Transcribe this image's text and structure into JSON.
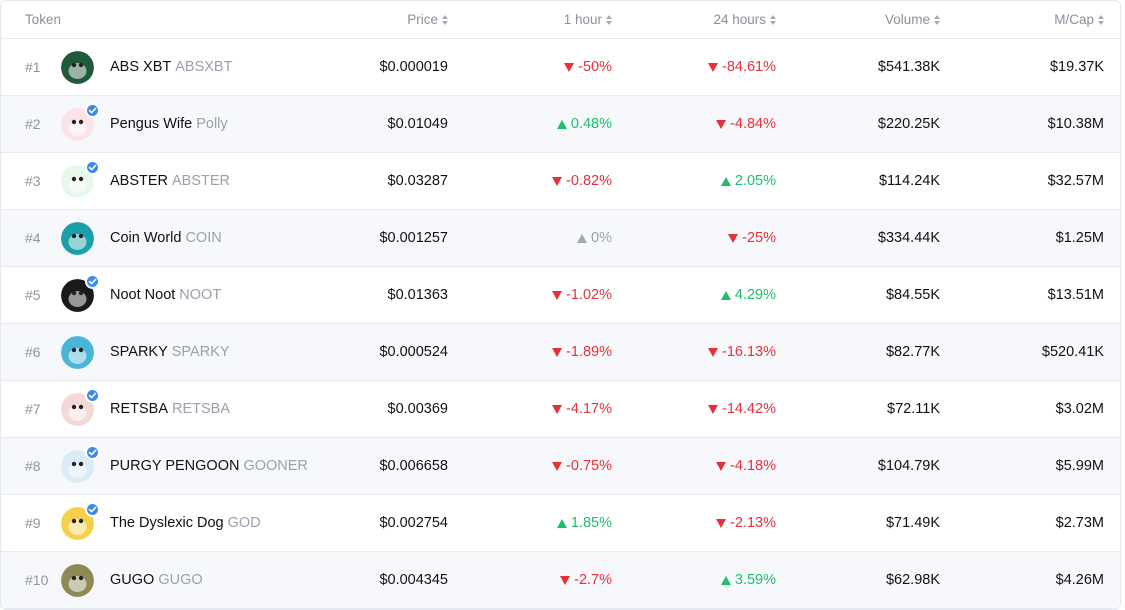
{
  "header": {
    "token": "Token",
    "price": "Price",
    "h1": "1 hour",
    "h24": "24 hours",
    "volume": "Volume",
    "mcap": "M/Cap"
  },
  "rows": [
    {
      "rank": "#1",
      "name": "ABS XBT",
      "symbol": "ABSXBT",
      "verified": false,
      "price": "$0.000019",
      "h1": "-50%",
      "h1_dir": "down",
      "h24": "-84.61%",
      "h24_dir": "down",
      "volume": "$541.38K",
      "mcap": "$19.37K",
      "avatar_color": "#1f5a3a",
      "avatar_icon": "frog-avatar-icon"
    },
    {
      "rank": "#2",
      "name": "Pengus Wife",
      "symbol": "Polly",
      "verified": true,
      "price": "$0.01049",
      "h1": "0.48%",
      "h1_dir": "up",
      "h24": "-4.84%",
      "h24_dir": "down",
      "volume": "$220.25K",
      "mcap": "$10.38M",
      "avatar_color": "#fbe3ea",
      "avatar_icon": "pink-penguin-avatar-icon"
    },
    {
      "rank": "#3",
      "name": "ABSTER",
      "symbol": "ABSTER",
      "verified": true,
      "price": "$0.03287",
      "h1": "-0.82%",
      "h1_dir": "down",
      "h24": "2.05%",
      "h24_dir": "up",
      "volume": "$114.24K",
      "mcap": "$32.57M",
      "avatar_color": "#e6f7ec",
      "avatar_icon": "green-mascot-avatar-icon"
    },
    {
      "rank": "#4",
      "name": "Coin World",
      "symbol": "COIN",
      "verified": false,
      "price": "$0.001257",
      "h1": "0%",
      "h1_dir": "flat",
      "h24": "-25%",
      "h24_dir": "down",
      "volume": "$334.44K",
      "mcap": "$1.25M",
      "avatar_color": "#1aa0a8",
      "avatar_icon": "penguin-avatar-icon"
    },
    {
      "rank": "#5",
      "name": "Noot Noot",
      "symbol": "NOOT",
      "verified": true,
      "price": "$0.01363",
      "h1": "-1.02%",
      "h1_dir": "down",
      "h24": "4.29%",
      "h24_dir": "up",
      "volume": "$84.55K",
      "mcap": "$13.51M",
      "avatar_color": "#1a1a1a",
      "avatar_icon": "black-penguin-avatar-icon"
    },
    {
      "rank": "#6",
      "name": "SPARKY",
      "symbol": "SPARKY",
      "verified": false,
      "price": "$0.000524",
      "h1": "-1.89%",
      "h1_dir": "down",
      "h24": "-16.13%",
      "h24_dir": "down",
      "volume": "$82.77K",
      "mcap": "$520.41K",
      "avatar_color": "#47b6d8",
      "avatar_icon": "spark-avatar-icon"
    },
    {
      "rank": "#7",
      "name": "RETSBA",
      "symbol": "RETSBA",
      "verified": true,
      "price": "$0.00369",
      "h1": "-4.17%",
      "h1_dir": "down",
      "h24": "-14.42%",
      "h24_dir": "down",
      "volume": "$72.11K",
      "mcap": "$3.02M",
      "avatar_color": "#f4d9d9",
      "avatar_icon": "red-mascot-avatar-icon"
    },
    {
      "rank": "#8",
      "name": "PURGY PENGOON",
      "symbol": "GOONER",
      "verified": true,
      "price": "$0.006658",
      "h1": "-0.75%",
      "h1_dir": "down",
      "h24": "-4.18%",
      "h24_dir": "down",
      "volume": "$104.79K",
      "mcap": "$5.99M",
      "avatar_color": "#dcecf7",
      "avatar_icon": "penguin-tongue-avatar-icon"
    },
    {
      "rank": "#9",
      "name": "The Dyslexic Dog",
      "symbol": "GOD",
      "verified": true,
      "price": "$0.002754",
      "h1": "1.85%",
      "h1_dir": "up",
      "h24": "-2.13%",
      "h24_dir": "down",
      "volume": "$71.49K",
      "mcap": "$2.73M",
      "avatar_color": "#f5d04a",
      "avatar_icon": "dog-avatar-icon"
    },
    {
      "rank": "#10",
      "name": "GUGO",
      "symbol": "GUGO",
      "verified": false,
      "price": "$0.004345",
      "h1": "-2.7%",
      "h1_dir": "down",
      "h24": "3.59%",
      "h24_dir": "up",
      "volume": "$62.98K",
      "mcap": "$4.26M",
      "avatar_color": "#8f8a55",
      "avatar_icon": "gugo-avatar-icon"
    }
  ],
  "colors": {
    "up": "#1fbe6a",
    "down": "#e5323a",
    "flat": "#a3a7b2",
    "verified": "#3f8ae8",
    "row_alt": "#f7f8fc"
  }
}
